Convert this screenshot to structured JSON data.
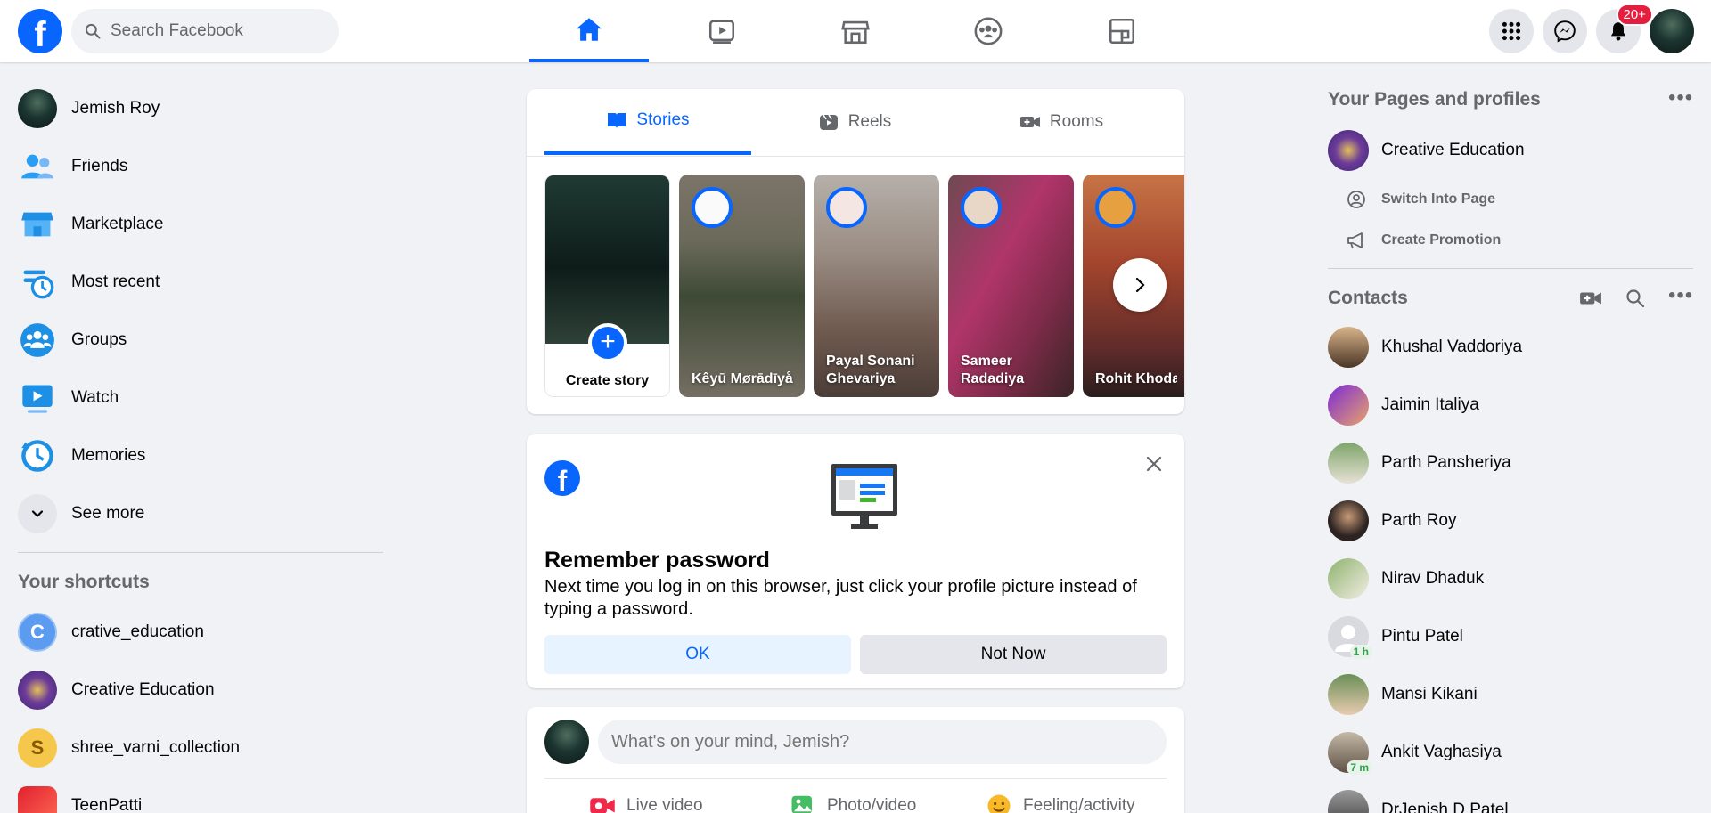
{
  "topbar": {
    "logo": "f",
    "search_placeholder": "Search Facebook",
    "notification_badge": "20+",
    "nav_tabs": [
      "home-icon",
      "watch-icon",
      "marketplace-icon",
      "groups-icon",
      "gaming-icon"
    ]
  },
  "left": {
    "items": [
      {
        "label": "Jemish Roy"
      },
      {
        "label": "Friends"
      },
      {
        "label": "Marketplace"
      },
      {
        "label": "Most recent"
      },
      {
        "label": "Groups"
      },
      {
        "label": "Watch"
      },
      {
        "label": "Memories"
      },
      {
        "label": "See more"
      }
    ],
    "shortcuts_title": "Your shortcuts",
    "shortcuts": [
      {
        "label": "crative_education",
        "initial": "C"
      },
      {
        "label": "Creative Education"
      },
      {
        "label": "shree_varni_collection",
        "initial": "S"
      },
      {
        "label": "TeenPatti"
      }
    ]
  },
  "stories": {
    "tabs": [
      {
        "label": "Stories"
      },
      {
        "label": "Reels"
      },
      {
        "label": "Rooms"
      }
    ],
    "create_label": "Create story",
    "items": [
      {
        "name": "Kêyū Mørādīyå"
      },
      {
        "name": "Payal Sonani Ghevariya"
      },
      {
        "name": "Sameer Radadiya"
      },
      {
        "name": "Rohit Khodal"
      }
    ]
  },
  "remember": {
    "title": "Remember password",
    "body": "Next time you log in on this browser, just click your profile picture instead of typing a password.",
    "ok_label": "OK",
    "not_now_label": "Not Now"
  },
  "composer": {
    "placeholder": "What's on your mind, Jemish?",
    "actions": [
      {
        "label": "Live video"
      },
      {
        "label": "Photo/video"
      },
      {
        "label": "Feeling/activity"
      }
    ]
  },
  "right": {
    "pages_title": "Your Pages and profiles",
    "page_name": "Creative Education",
    "switch_label": "Switch Into Page",
    "promotion_label": "Create Promotion",
    "contacts_title": "Contacts",
    "contacts": [
      {
        "name": "Khushal Vaddoriya"
      },
      {
        "name": "Jaimin Italiya"
      },
      {
        "name": "Parth Pansheriya"
      },
      {
        "name": "Parth Roy"
      },
      {
        "name": "Nirav Dhaduk"
      },
      {
        "name": "Pintu Patel",
        "badge": "1 h"
      },
      {
        "name": "Mansi Kikani"
      },
      {
        "name": "Ankit Vaghasiya",
        "badge": "7 m"
      },
      {
        "name": "DrJenish D Patel"
      }
    ]
  },
  "colors": {
    "brand": "#0866ff",
    "background": "#f0f2f5",
    "notification": "#e41e3f"
  }
}
